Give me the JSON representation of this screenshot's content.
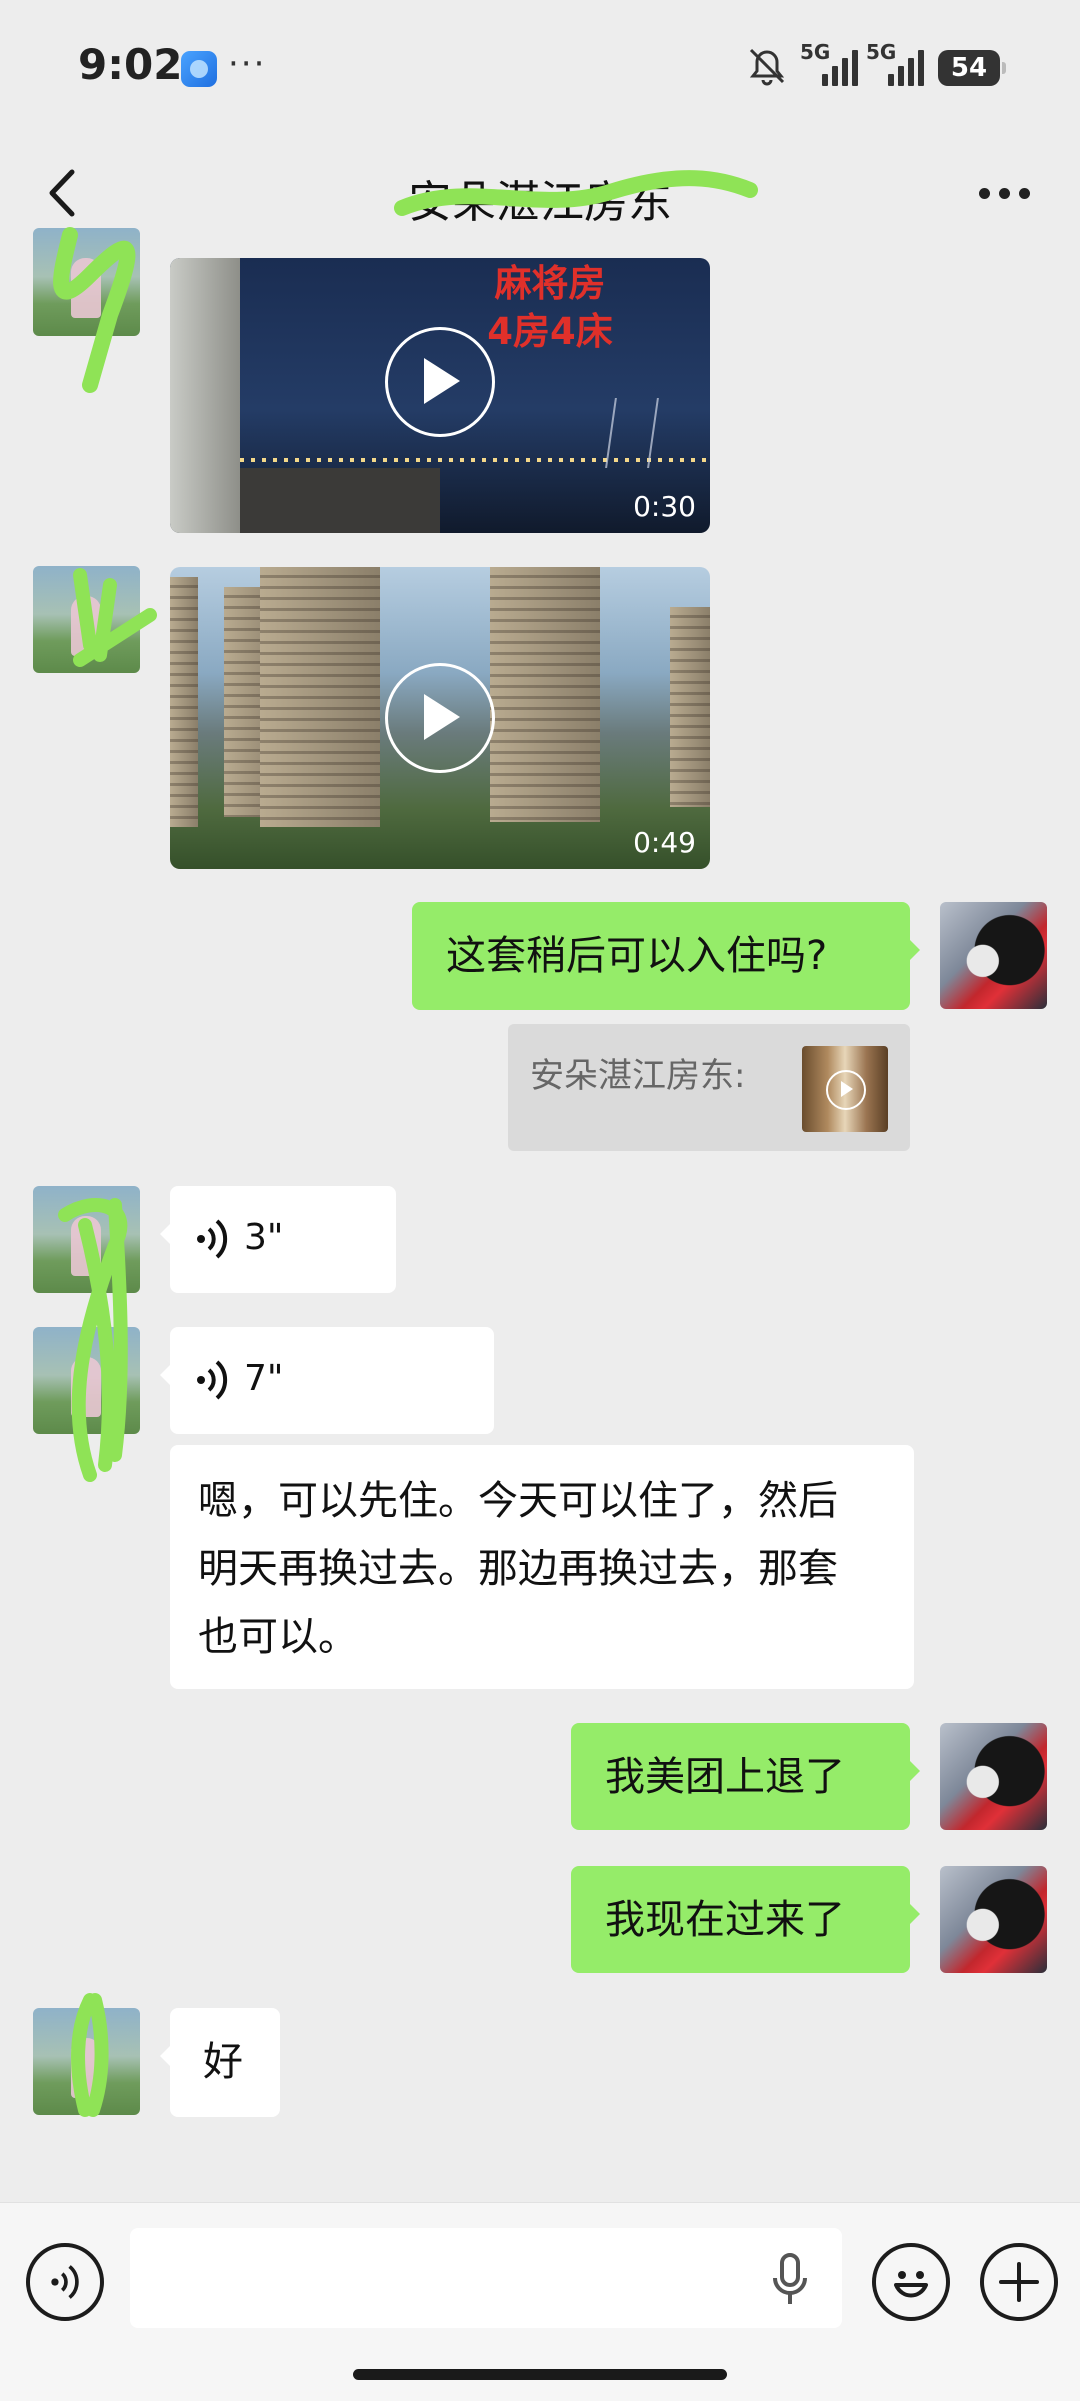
{
  "status_bar": {
    "time": "9:02",
    "dots": "···",
    "network_1": "5G",
    "network_2": "5G",
    "battery": "54"
  },
  "header": {
    "title": "安朵湛江房东"
  },
  "messages": {
    "video1": {
      "overlay_line1": "麻将房",
      "overlay_line2": "4房4床",
      "duration": "0:30"
    },
    "video2": {
      "duration": "0:49"
    },
    "msg_ask": "这套稍后可以入住吗?",
    "quote_label": "安朵湛江房东:",
    "voice1_duration": "3\"",
    "voice2_duration": "7\"",
    "msg_reply_long": "嗯，可以先住。今天可以住了，然后明天再换过去。那边再换过去，那套也可以。",
    "msg_refund": "我美团上退了",
    "msg_coming": "我现在过来了",
    "msg_ok": "好"
  },
  "input": {
    "value": "",
    "placeholder": ""
  },
  "colors": {
    "background": "#ededed",
    "outgoing_bubble": "#95ec69",
    "incoming_bubble": "#ffffff",
    "redaction_marker": "#8fe356"
  },
  "icons": [
    "back-icon",
    "more-icon",
    "play-icon",
    "voice-wave-icon",
    "mic-icon",
    "voice-mode-icon",
    "emoji-icon",
    "plus-icon",
    "mute-icon",
    "battery-icon"
  ]
}
